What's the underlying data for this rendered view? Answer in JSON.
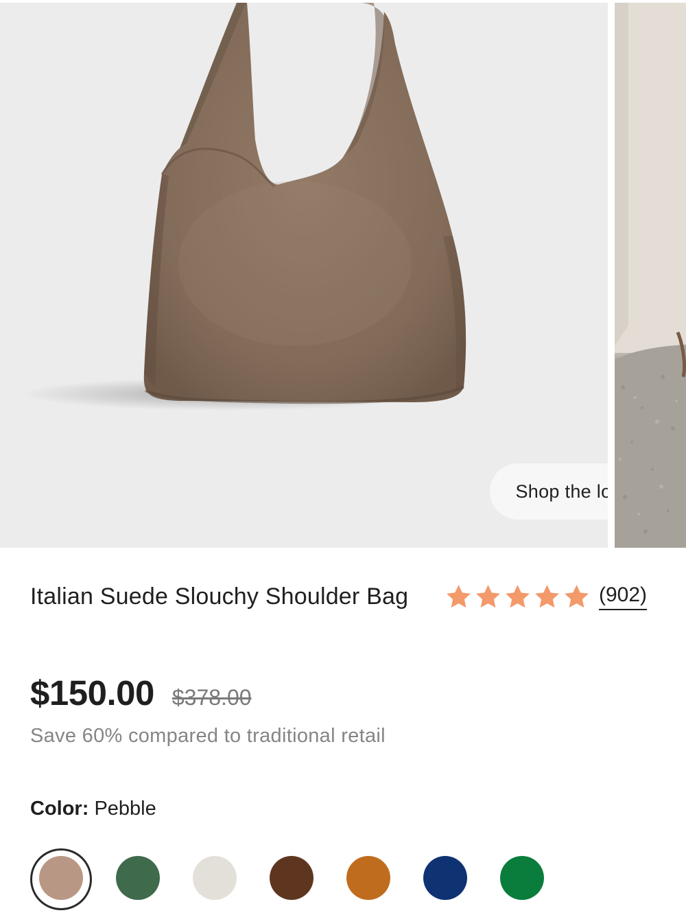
{
  "gallery": {
    "shop_the_look_label": "Shop the look"
  },
  "product": {
    "title": "Italian Suede Slouchy Shoulder Bag",
    "rating": {
      "stars": 5,
      "review_count": "(902)",
      "star_color": "#f3996a"
    },
    "price": {
      "current": "$150.00",
      "original": "$378.00"
    },
    "savings_text": "Save 60% compared to traditional retail",
    "color": {
      "label": "Color:",
      "selected": "Pebble"
    },
    "swatches": [
      {
        "color": "#b89885",
        "selected": true
      },
      {
        "color": "#3f6a4c",
        "selected": false
      },
      {
        "color": "#e2e0d9",
        "selected": false
      },
      {
        "color": "#5e3620",
        "selected": false
      },
      {
        "color": "#c06c1e",
        "selected": false
      },
      {
        "color": "#0f3273",
        "selected": false
      },
      {
        "color": "#0a7d3d",
        "selected": false
      }
    ]
  }
}
